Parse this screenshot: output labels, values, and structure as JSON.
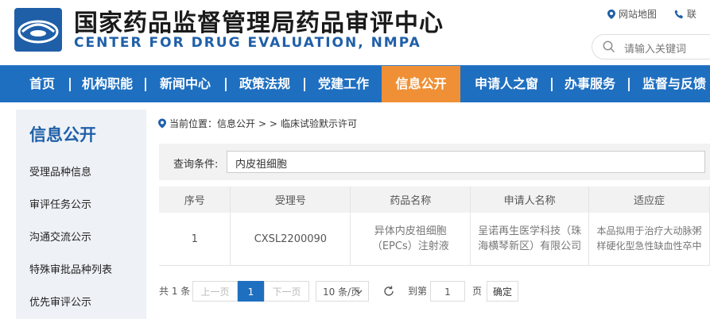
{
  "header": {
    "title_cn": "国家药品监督管理局药品审评中心",
    "title_en": "CENTER FOR DRUG EVALUATION, NMPA",
    "sitemap_label": "网站地图",
    "contact_label": "联",
    "search_placeholder": "请输入关键词"
  },
  "nav": {
    "items": [
      "首页",
      "机构职能",
      "新闻中心",
      "政策法规",
      "党建工作",
      "信息公开",
      "申请人之窗",
      "办事服务",
      "监督与反馈"
    ],
    "active_index": 5
  },
  "sidebar": {
    "title": "信息公开",
    "items": [
      "受理品种信息",
      "审评任务公示",
      "沟通交流公示",
      "特殊审批品种列表",
      "优先审评公示"
    ]
  },
  "breadcrumb": {
    "prefix": "当前位置：信息公开",
    "separator": "> >",
    "current": "临床试验默示许可"
  },
  "query": {
    "label": "查询条件:",
    "value": "内皮祖细胞"
  },
  "table": {
    "headers": [
      "序号",
      "受理号",
      "药品名称",
      "申请人名称",
      "适应症"
    ],
    "rows": [
      [
        "1",
        "CXSL2200090",
        "异体内皮祖细胞（EPCs）注射液",
        "呈诺再生医学科技（珠海横琴新区）有限公司",
        "本品拟用于治疗大动脉粥样硬化型急性缺血性卒中"
      ]
    ]
  },
  "pagination": {
    "total": "共 1 条",
    "prev": "上一页",
    "current_page": "1",
    "next": "下一页",
    "page_size": "10 条/页",
    "goto_label": "到第",
    "goto_value": "1",
    "page_unit": "页",
    "confirm": "确定"
  },
  "colors": {
    "nav_bg": "#1f6fc0",
    "nav_active": "#f09036",
    "brand_blue": "#1f5fa8"
  }
}
